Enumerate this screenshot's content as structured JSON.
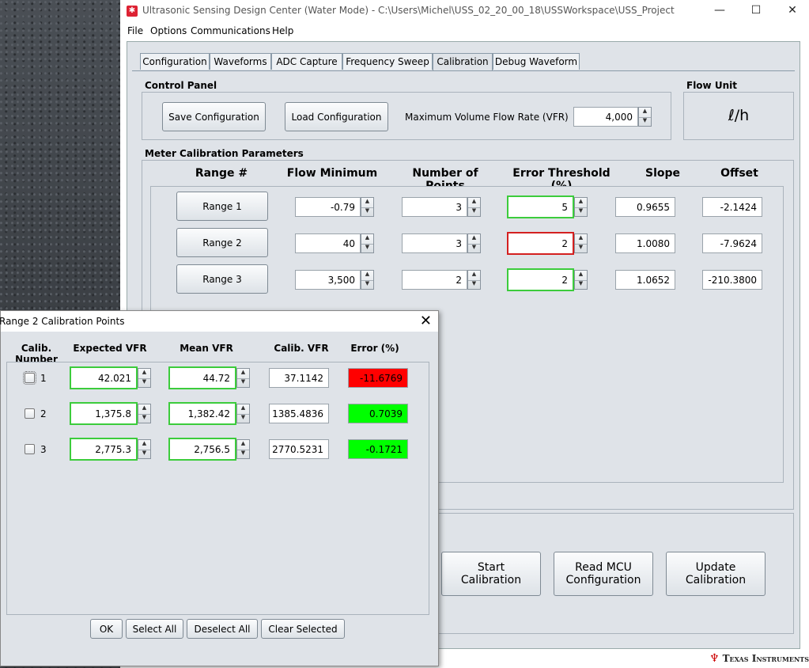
{
  "window": {
    "title": "Ultrasonic Sensing Design Center (Water Mode) - C:\\Users\\Michel\\USS_02_20_00_18\\USSWorkspace\\USS_Project",
    "icon": "app-icon",
    "minimize": "—",
    "maximize": "☐",
    "close": "✕"
  },
  "menu": [
    "File",
    "Options",
    "Communications",
    "Help"
  ],
  "tabs": [
    "Configuration",
    "Waveforms",
    "ADC Capture",
    "Frequency Sweep",
    "Calibration",
    "Debug Waveform"
  ],
  "active_tab": "Calibration",
  "control_panel": {
    "label": "Control Panel",
    "save_label": "Save Configuration",
    "load_label": "Load Configuration",
    "max_vfr_label": "Maximum Volume Flow Rate (VFR)",
    "max_vfr_value": "4,000"
  },
  "flow_unit": {
    "label": "Flow Unit",
    "value": "ℓ/h"
  },
  "meter": {
    "label": "Meter Calibration Parameters",
    "headers": [
      "Range #",
      "Flow Minimum",
      "Number of Points",
      "Error Threshold (%)",
      "Slope",
      "Offset"
    ],
    "rows": [
      {
        "range": "Range 1",
        "flow_min": "-0.79",
        "points": "3",
        "threshold": "5",
        "threshold_state": "ok",
        "slope": "0.9655",
        "offset": "-2.1424"
      },
      {
        "range": "Range 2",
        "flow_min": "40",
        "points": "3",
        "threshold": "2",
        "threshold_state": "error",
        "slope": "1.0080",
        "offset": "-7.9624"
      },
      {
        "range": "Range 3",
        "flow_min": "3,500",
        "points": "2",
        "threshold": "2",
        "threshold_state": "ok",
        "slope": "1.0652",
        "offset": "-210.3800"
      }
    ]
  },
  "actions": {
    "start_line1": "Start",
    "start_line2": "Calibration",
    "read_line1": "Read MCU",
    "read_line2": "Configuration",
    "update_line1": "Update",
    "update_line2": "Calibration"
  },
  "footer": {
    "brand": "Texas Instruments"
  },
  "dialog": {
    "title": "Range 2 Calibration Points",
    "headers": [
      "Calib. Number",
      "Expected VFR",
      "Mean VFR",
      "Calib. VFR",
      "Error (%)"
    ],
    "rows": [
      {
        "num": "1",
        "expected": "42.021",
        "mean": "44.72",
        "calib": "37.1142",
        "error": "-11.6769",
        "error_status": "fail"
      },
      {
        "num": "2",
        "expected": "1,375.8",
        "mean": "1,382.42",
        "calib": "1385.4836",
        "error": "0.7039",
        "error_status": "pass"
      },
      {
        "num": "3",
        "expected": "2,775.3",
        "mean": "2,756.5",
        "calib": "2770.5231",
        "error": "-0.1721",
        "error_status": "pass"
      }
    ],
    "buttons": {
      "ok": "OK",
      "select_all": "Select All",
      "deselect_all": "Deselect All",
      "clear_selected": "Clear Selected"
    },
    "close": "✕"
  },
  "colors": {
    "ok_border": "#3ccc3c",
    "error_border": "#d42020",
    "fail_bg": "#ff0000",
    "pass_bg": "#00ff00",
    "panel_bg": "#dfe3e8"
  }
}
